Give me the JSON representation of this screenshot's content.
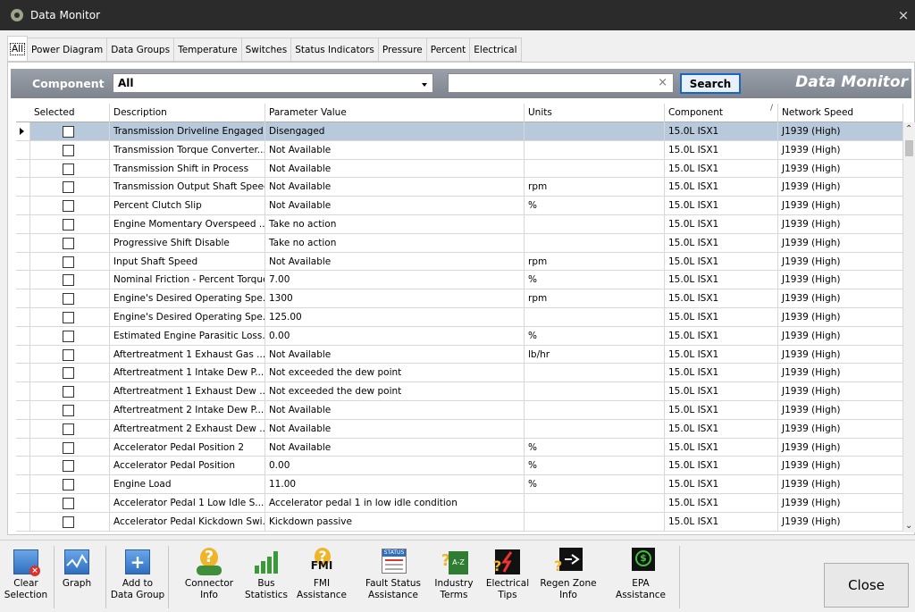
{
  "window": {
    "title": "Data Monitor",
    "close_glyph": "×"
  },
  "tabs": [
    "All",
    "Power Diagram",
    "Data Groups",
    "Temperature",
    "Switches",
    "Status Indicators",
    "Pressure",
    "Percent",
    "Electrical"
  ],
  "filter": {
    "component_label": "Component",
    "component_value": "All",
    "search_value": "",
    "search_clear": "×",
    "search_button": "Search",
    "brand": "Data Monitor"
  },
  "grid": {
    "columns": [
      "Selected",
      "Description",
      "Parameter Value",
      "Units",
      "Component",
      "Network Speed"
    ],
    "rows": [
      {
        "description": "Transmission Driveline Engaged",
        "value": "Disengaged",
        "units": "",
        "component": "15.0L ISX1",
        "speed": "J1939 (High)",
        "selected": true
      },
      {
        "description": "Transmission Torque Converter...",
        "value": "Not Available",
        "units": "",
        "component": "15.0L ISX1",
        "speed": "J1939 (High)"
      },
      {
        "description": "Transmission Shift in Process",
        "value": "Not Available",
        "units": "",
        "component": "15.0L ISX1",
        "speed": "J1939 (High)"
      },
      {
        "description": "Transmission Output Shaft Speed",
        "value": "Not Available",
        "units": "rpm",
        "component": "15.0L ISX1",
        "speed": "J1939 (High)"
      },
      {
        "description": "Percent Clutch Slip",
        "value": "Not Available",
        "units": "%",
        "component": "15.0L ISX1",
        "speed": "J1939 (High)"
      },
      {
        "description": "Engine Momentary Overspeed ...",
        "value": "Take no action",
        "units": "",
        "component": "15.0L ISX1",
        "speed": "J1939 (High)"
      },
      {
        "description": "Progressive Shift Disable",
        "value": "Take no action",
        "units": "",
        "component": "15.0L ISX1",
        "speed": "J1939 (High)"
      },
      {
        "description": "Input Shaft Speed",
        "value": "Not Available",
        "units": "rpm",
        "component": "15.0L ISX1",
        "speed": "J1939 (High)"
      },
      {
        "description": "Nominal Friction - Percent Torque",
        "value": "7.00",
        "units": "%",
        "component": "15.0L ISX1",
        "speed": "J1939 (High)"
      },
      {
        "description": "Engine's Desired Operating Spe...",
        "value": "1300",
        "units": "rpm",
        "component": "15.0L ISX1",
        "speed": "J1939 (High)"
      },
      {
        "description": "Engine's Desired Operating Spe...",
        "value": "125.00",
        "units": "",
        "component": "15.0L ISX1",
        "speed": "J1939 (High)"
      },
      {
        "description": "Estimated Engine Parasitic Loss...",
        "value": "0.00",
        "units": "%",
        "component": "15.0L ISX1",
        "speed": "J1939 (High)"
      },
      {
        "description": "Aftertreatment 1 Exhaust Gas ...",
        "value": "Not Available",
        "units": "lb/hr",
        "component": "15.0L ISX1",
        "speed": "J1939 (High)"
      },
      {
        "description": "Aftertreatment 1 Intake Dew P...",
        "value": "Not exceeded the dew point",
        "units": "",
        "component": "15.0L ISX1",
        "speed": "J1939 (High)"
      },
      {
        "description": "Aftertreatment 1 Exhaust Dew ...",
        "value": "Not exceeded the dew point",
        "units": "",
        "component": "15.0L ISX1",
        "speed": "J1939 (High)"
      },
      {
        "description": "Aftertreatment 2 Intake Dew P...",
        "value": "Not Available",
        "units": "",
        "component": "15.0L ISX1",
        "speed": "J1939 (High)"
      },
      {
        "description": "Aftertreatment 2 Exhaust Dew ...",
        "value": "Not Available",
        "units": "",
        "component": "15.0L ISX1",
        "speed": "J1939 (High)"
      },
      {
        "description": "Accelerator Pedal Position 2",
        "value": "Not Available",
        "units": "%",
        "component": "15.0L ISX1",
        "speed": "J1939 (High)"
      },
      {
        "description": "Accelerator Pedal Position",
        "value": "0.00",
        "units": "%",
        "component": "15.0L ISX1",
        "speed": "J1939 (High)"
      },
      {
        "description": "Engine Load",
        "value": "11.00",
        "units": "%",
        "component": "15.0L ISX1",
        "speed": "J1939 (High)"
      },
      {
        "description": "Accelerator Pedal 1 Low Idle S...",
        "value": "Accelerator pedal 1 in low idle condition",
        "units": "",
        "component": "15.0L ISX1",
        "speed": "J1939 (High)"
      },
      {
        "description": "Accelerator Pedal Kickdown Swi...",
        "value": "Kickdown passive",
        "units": "",
        "component": "15.0L ISX1",
        "speed": "J1939 (High)"
      }
    ]
  },
  "toolbar": {
    "buttons": [
      {
        "label1": "Clear",
        "label2": "Selection",
        "icon": "clear-selection-icon"
      },
      {
        "label1": "Graph",
        "label2": "",
        "icon": "graph-icon"
      },
      {
        "label1": "Add to",
        "label2": "Data Group",
        "icon": "add-to-group-icon"
      },
      {
        "label1": "Connector",
        "label2": "Info",
        "icon": "connector-info-icon"
      },
      {
        "label1": "Bus",
        "label2": "Statistics",
        "icon": "bus-statistics-icon"
      },
      {
        "label1": "FMI",
        "label2": "Assistance",
        "icon": "fmi-assistance-icon",
        "icon_text": "FMI"
      },
      {
        "label1": "Fault Status",
        "label2": "Assistance",
        "icon": "fault-status-icon",
        "icon_text": "STATUS"
      },
      {
        "label1": "Industry",
        "label2": "Terms",
        "icon": "industry-terms-icon",
        "icon_text": "A-Z"
      },
      {
        "label1": "Electrical",
        "label2": "Tips",
        "icon": "electrical-tips-icon"
      },
      {
        "label1": "Regen Zone",
        "label2": "Info",
        "icon": "regen-zone-icon"
      },
      {
        "label1": "EPA",
        "label2": "Assistance",
        "icon": "epa-assistance-icon"
      }
    ],
    "close": "Close"
  }
}
